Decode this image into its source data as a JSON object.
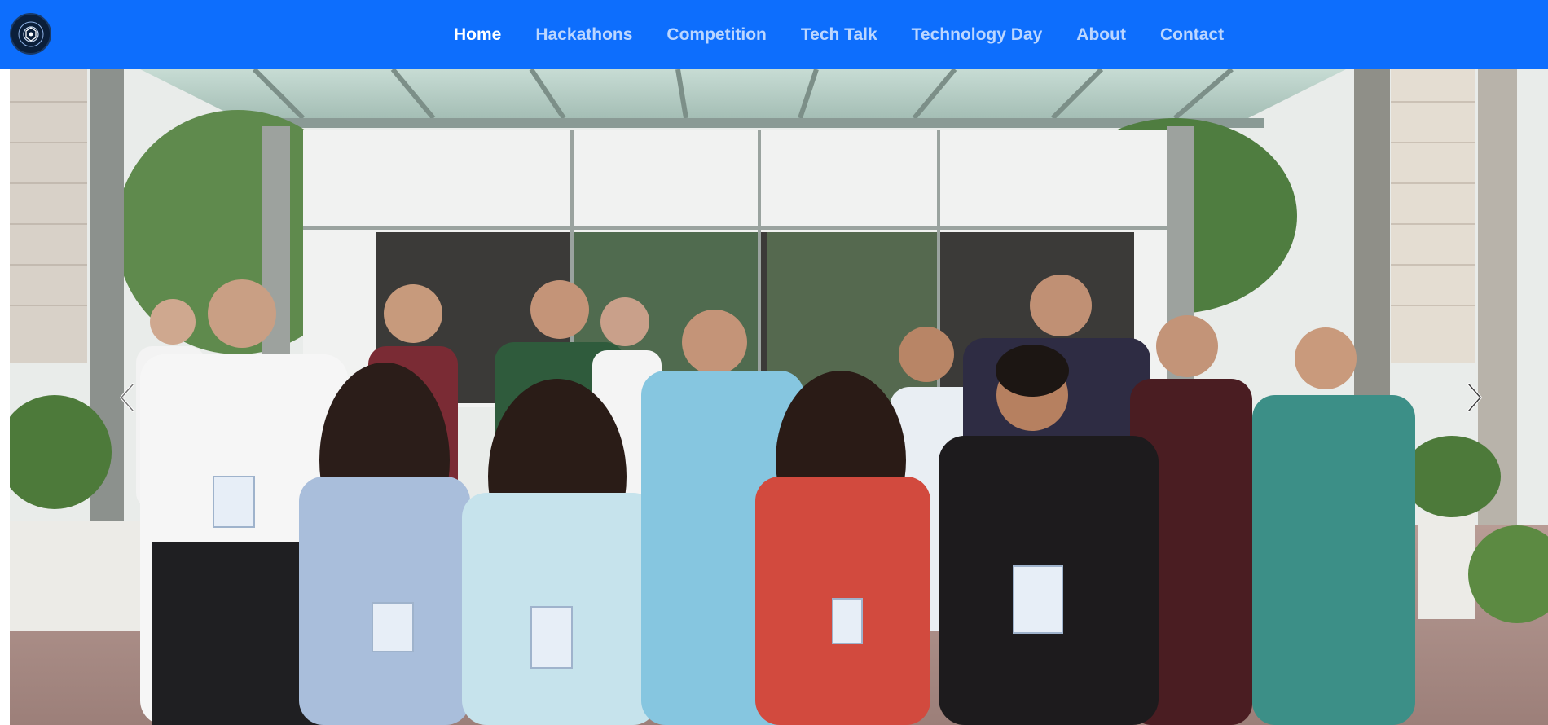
{
  "navbar": {
    "logo_icon": "college-emblem-logo",
    "background_color": "#0d6efd",
    "links": [
      {
        "label": "Home",
        "active": true
      },
      {
        "label": "Hackathons",
        "active": false
      },
      {
        "label": "Competition",
        "active": false
      },
      {
        "label": "Tech Talk",
        "active": false
      },
      {
        "label": "Technology Day",
        "active": false
      },
      {
        "label": "About",
        "active": false
      },
      {
        "label": "Contact",
        "active": false
      }
    ]
  },
  "carousel": {
    "current_slide_description": "group-photo",
    "prev_icon": "chevron-left-icon",
    "next_icon": "chevron-right-icon"
  }
}
